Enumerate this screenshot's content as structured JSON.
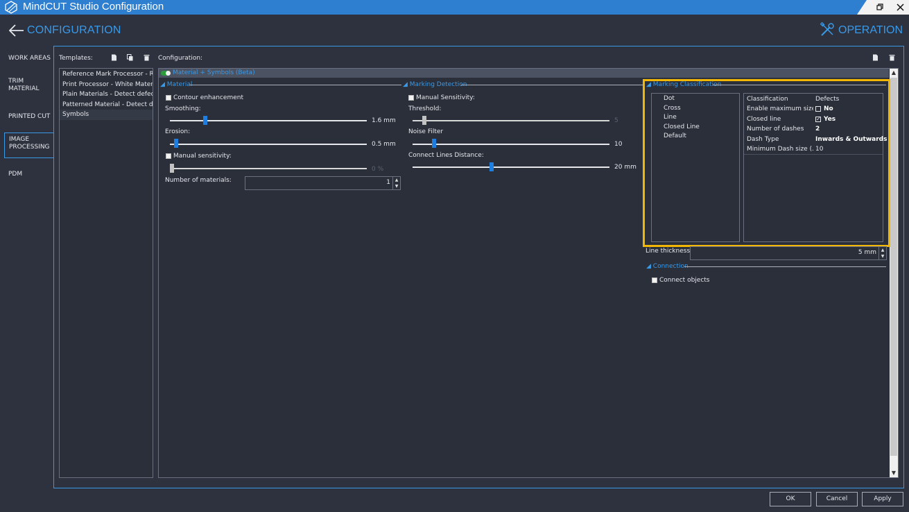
{
  "window": {
    "title": "MindCUT Studio Configuration"
  },
  "header": {
    "title": "CONFIGURATION",
    "operation_label": "OPERATION"
  },
  "sidebar": {
    "items": [
      {
        "label": "WORK AREAS"
      },
      {
        "label": "TRIM\nMATERIAL"
      },
      {
        "label": "PRINTED CUT"
      },
      {
        "label": "IMAGE\nPROCESSING",
        "active": true
      },
      {
        "label": "PDM"
      }
    ]
  },
  "templates": {
    "label": "Templates:",
    "items": [
      "Reference Mark Processor - R...",
      "Print Processor - White Materi...",
      "Plain Materials - Detect defects",
      "Patterned Material - Detect de...",
      "Symbols"
    ]
  },
  "configuration": {
    "label": "Configuration:",
    "header_title": "Material + Symbols (Beta)",
    "material": {
      "title": "Material",
      "contour_enhancement": "Contour enhancement",
      "smoothing_label": "Smoothing:",
      "smoothing_value": "1.6 mm",
      "smoothing_level": 0.17,
      "erosion_label": "Erosion:",
      "erosion_value": "0.5 mm",
      "erosion_level": 0.02,
      "manual_sensitivity": "Manual sensitivity:",
      "sensitivity_value": "0 %",
      "sensitivity_level": 0.0,
      "num_materials_label": "Number of materials:",
      "num_materials_value": "1"
    },
    "marking_detection": {
      "title": "Marking Detection",
      "manual_sensitivity": "Manual Sensitivity:",
      "threshold_label": "Threshold:",
      "threshold_value": "5",
      "threshold_level": 0.05,
      "noise_label": "Noise Filter",
      "noise_value": "10",
      "noise_level": 0.1,
      "connect_label": "Connect Lines Distance:",
      "connect_value": "20 mm",
      "connect_level": 0.39
    },
    "marking_classification": {
      "title": "Marking Classification",
      "list": [
        "Dot",
        "Cross",
        "Line",
        "Closed Line",
        "Default"
      ],
      "grid": [
        {
          "key": "Classification",
          "value": "Defects",
          "bold": false
        },
        {
          "key": "Enable maximum size",
          "value": "No",
          "bold": true,
          "check": false
        },
        {
          "key": "Closed line",
          "value": "Yes",
          "bold": true,
          "check": true
        },
        {
          "key": "Number of dashes",
          "value": "2",
          "bold": true
        },
        {
          "key": "Dash Type",
          "value": "Inwards & Outwards",
          "bold": true
        },
        {
          "key": "Minimum Dash size (...",
          "value": "10",
          "bold": false
        }
      ],
      "line_thickness_label": "Line thickness:",
      "line_thickness_value": "5 mm"
    },
    "connection": {
      "title": "Connection",
      "connect_objects": "Connect objects"
    }
  },
  "buttons": {
    "ok": "OK",
    "cancel": "Cancel",
    "apply": "Apply"
  },
  "colors": {
    "accent": "#3a9ae8",
    "highlight": "#f2b705",
    "titlebar": "#2f7fd0",
    "background": "#2d323e"
  }
}
